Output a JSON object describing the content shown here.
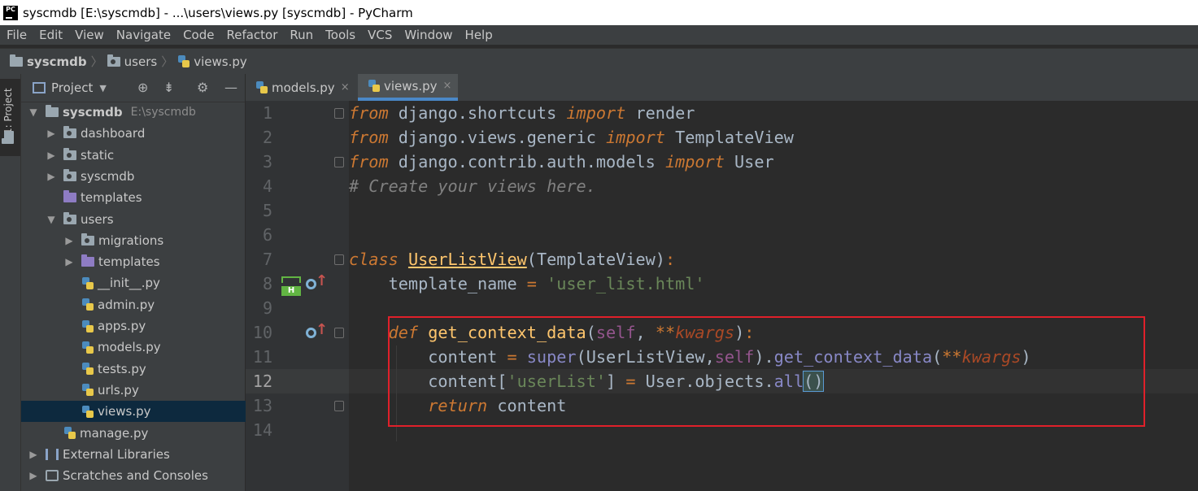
{
  "window": {
    "title": "syscmdb [E:\\syscmdb] - ...\\users\\views.py [syscmdb] - PyCharm",
    "app_icon_text": "PC"
  },
  "menu": [
    "File",
    "Edit",
    "View",
    "Navigate",
    "Code",
    "Refactor",
    "Run",
    "Tools",
    "VCS",
    "Window",
    "Help"
  ],
  "breadcrumb": [
    "syscmdb",
    "users",
    "views.py"
  ],
  "toolwindow": {
    "vertical_tab": "1: Project",
    "title": "Project"
  },
  "tree": [
    {
      "label": "syscmdb",
      "hint": "E:\\syscmdb",
      "icon": "folder",
      "indent": 0,
      "arrow": "down",
      "bold": true
    },
    {
      "label": "dashboard",
      "icon": "folder-module",
      "indent": 1,
      "arrow": "right"
    },
    {
      "label": "static",
      "icon": "folder-module",
      "indent": 1,
      "arrow": "right"
    },
    {
      "label": "syscmdb",
      "icon": "folder-module",
      "indent": 1,
      "arrow": "right"
    },
    {
      "label": "templates",
      "icon": "folder-purple",
      "indent": 1,
      "arrow": ""
    },
    {
      "label": "users",
      "icon": "folder-module",
      "indent": 1,
      "arrow": "down"
    },
    {
      "label": "migrations",
      "icon": "folder-module",
      "indent": 2,
      "arrow": "right"
    },
    {
      "label": "templates",
      "icon": "folder-purple",
      "indent": 2,
      "arrow": "right"
    },
    {
      "label": "__init__.py",
      "icon": "python-file",
      "indent": 2,
      "arrow": ""
    },
    {
      "label": "admin.py",
      "icon": "python-file",
      "indent": 2,
      "arrow": ""
    },
    {
      "label": "apps.py",
      "icon": "python-file",
      "indent": 2,
      "arrow": ""
    },
    {
      "label": "models.py",
      "icon": "python-file",
      "indent": 2,
      "arrow": ""
    },
    {
      "label": "tests.py",
      "icon": "python-file",
      "indent": 2,
      "arrow": ""
    },
    {
      "label": "urls.py",
      "icon": "python-file",
      "indent": 2,
      "arrow": ""
    },
    {
      "label": "views.py",
      "icon": "python-file",
      "indent": 2,
      "arrow": "",
      "selected": true
    },
    {
      "label": "manage.py",
      "icon": "python-file",
      "indent": 1,
      "arrow": ""
    },
    {
      "label": "External Libraries",
      "icon": "library",
      "indent": 0,
      "arrow": "right"
    },
    {
      "label": "Scratches and Consoles",
      "icon": "scratches",
      "indent": 0,
      "arrow": "right"
    }
  ],
  "tabs": [
    {
      "label": "models.py",
      "close": "×",
      "active": false
    },
    {
      "label": "views.py",
      "close": "×",
      "active": true
    }
  ],
  "line_numbers": [
    "1",
    "2",
    "3",
    "4",
    "5",
    "6",
    "7",
    "8",
    "9",
    "10",
    "11",
    "12",
    "13",
    "14"
  ],
  "code_lines": [
    [
      {
        "t": "from",
        "c": "kw"
      },
      {
        "t": " django.shortcuts "
      },
      {
        "t": "import",
        "c": "kw"
      },
      {
        "t": " render"
      }
    ],
    [
      {
        "t": "from",
        "c": "kw"
      },
      {
        "t": " django.views.generic "
      },
      {
        "t": "import",
        "c": "kw"
      },
      {
        "t": " TemplateView"
      }
    ],
    [
      {
        "t": "from",
        "c": "kw"
      },
      {
        "t": " django.contrib.auth.models "
      },
      {
        "t": "import",
        "c": "kw"
      },
      {
        "t": " User"
      }
    ],
    [
      {
        "t": "# Create your views here.",
        "c": "cmt"
      }
    ],
    [],
    [],
    [
      {
        "t": "class",
        "c": "kw"
      },
      {
        "t": " "
      },
      {
        "t": "UserListView",
        "c": "cls"
      },
      {
        "t": "(TemplateView)"
      },
      {
        "t": ":",
        "c": "kw2"
      }
    ],
    [
      {
        "t": "    template_name "
      },
      {
        "t": "=",
        "c": "kw2"
      },
      {
        "t": " "
      },
      {
        "t": "'user_list.html'",
        "c": "str"
      }
    ],
    [],
    [
      {
        "t": "    "
      },
      {
        "t": "def",
        "c": "kw"
      },
      {
        "t": " "
      },
      {
        "t": "get_context_data",
        "c": "fn"
      },
      {
        "t": "("
      },
      {
        "t": "self",
        "c": "slf"
      },
      {
        "t": ", "
      },
      {
        "t": "**",
        "c": "kw2"
      },
      {
        "t": "kwargs",
        "c": "kwarg"
      },
      {
        "t": ")"
      },
      {
        "t": ":",
        "c": "kw2"
      }
    ],
    [
      {
        "t": "        content "
      },
      {
        "t": "=",
        "c": "kw2"
      },
      {
        "t": " "
      },
      {
        "t": "super",
        "c": "sup"
      },
      {
        "t": "(UserListView,"
      },
      {
        "t": "self",
        "c": "slf"
      },
      {
        "t": ")."
      },
      {
        "t": "get_context_data",
        "c": "sup"
      },
      {
        "t": "("
      },
      {
        "t": "**",
        "c": "kw2"
      },
      {
        "t": "kwargs",
        "c": "kwarg"
      },
      {
        "t": ")"
      }
    ],
    [
      {
        "t": "        content["
      },
      {
        "t": "'userList'",
        "c": "str"
      },
      {
        "t": "] "
      },
      {
        "t": "=",
        "c": "kw2"
      },
      {
        "t": " User.objects."
      },
      {
        "t": "all",
        "c": "sup"
      },
      {
        "t": "()",
        "c": "bracehl"
      }
    ],
    [
      {
        "t": "        "
      },
      {
        "t": "return",
        "c": "kw"
      },
      {
        "t": " content"
      }
    ],
    []
  ],
  "current_line": "12"
}
